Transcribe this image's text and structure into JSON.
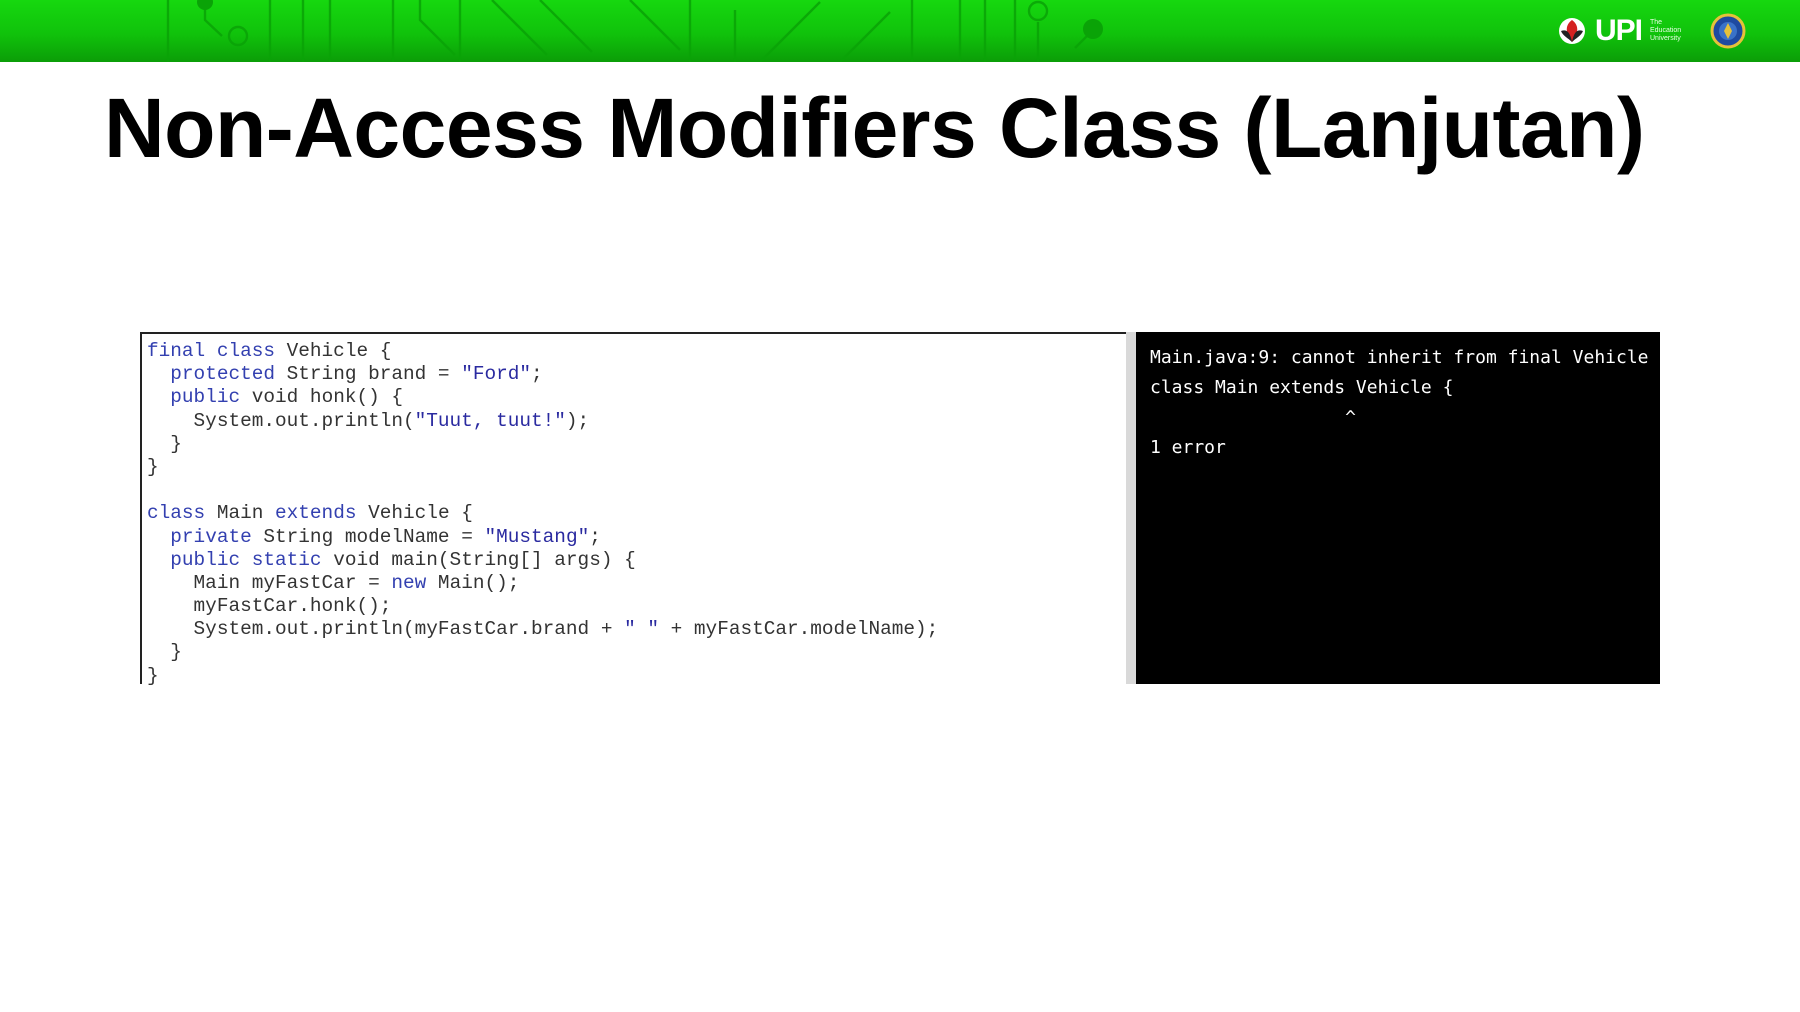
{
  "header": {
    "logo_text": "UPI",
    "logo_tagline": "The Education University"
  },
  "slide": {
    "title": "Non-Access Modifiers Class (Lanjutan)"
  },
  "code": {
    "lines": [
      [
        {
          "t": "final class",
          "k": "kw"
        },
        {
          "t": " Vehicle {"
        }
      ],
      [
        {
          "t": "  "
        },
        {
          "t": "protected",
          "k": "kw"
        },
        {
          "t": " String brand = "
        },
        {
          "t": "\"Ford\"",
          "k": "str"
        },
        {
          "t": ";"
        }
      ],
      [
        {
          "t": "  "
        },
        {
          "t": "public",
          "k": "kw"
        },
        {
          "t": " void honk() {"
        }
      ],
      [
        {
          "t": "    System.out.println("
        },
        {
          "t": "\"Tuut, tuut!\"",
          "k": "str"
        },
        {
          "t": ");"
        }
      ],
      [
        {
          "t": "  }"
        }
      ],
      [
        {
          "t": "}"
        }
      ],
      [
        {
          "t": ""
        }
      ],
      [
        {
          "t": "class",
          "k": "kw"
        },
        {
          "t": " Main "
        },
        {
          "t": "extends",
          "k": "kw"
        },
        {
          "t": " Vehicle {"
        }
      ],
      [
        {
          "t": "  "
        },
        {
          "t": "private",
          "k": "kw"
        },
        {
          "t": " String modelName = "
        },
        {
          "t": "\"Mustang\"",
          "k": "str"
        },
        {
          "t": ";"
        }
      ],
      [
        {
          "t": "  "
        },
        {
          "t": "public static",
          "k": "kw"
        },
        {
          "t": " void main(String[] args) {"
        }
      ],
      [
        {
          "t": "    Main myFastCar = "
        },
        {
          "t": "new",
          "k": "kw"
        },
        {
          "t": " Main();"
        }
      ],
      [
        {
          "t": "    myFastCar.honk();"
        }
      ],
      [
        {
          "t": "    System.out.println(myFastCar.brand + "
        },
        {
          "t": "\" \"",
          "k": "str"
        },
        {
          "t": " + myFastCar.modelName);"
        }
      ],
      [
        {
          "t": "  }"
        }
      ],
      [
        {
          "t": "}"
        }
      ]
    ]
  },
  "console": {
    "lines": [
      "Main.java:9: cannot inherit from final Vehicle",
      "class Main extends Vehicle {",
      "                  ^",
      "1 error"
    ]
  },
  "colors": {
    "header_green": "#10c20b",
    "keyword_blue": "#3340b0",
    "string_blue": "#2a2aa0",
    "console_bg": "#000000"
  }
}
